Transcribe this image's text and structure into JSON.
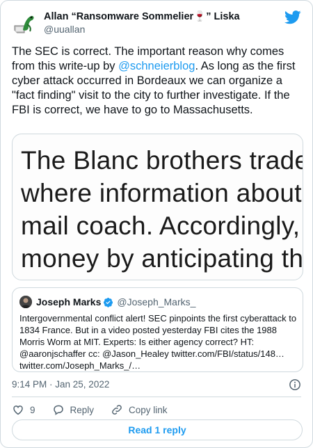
{
  "author": {
    "display_name": "Allan “Ransomware Sommelier🍷” Liska",
    "handle": "@uuallan"
  },
  "tweet": {
    "text_before": "The SEC is correct. The important reason why comes from this write-up by ",
    "mention": "@schneierblog",
    "text_after": ". As long as the first cyber attack occurred in Bordeaux we can organize a \"fact finding\" visit to the city to further investigate. If the FBI is correct, we have to go to Massachusetts."
  },
  "media": {
    "lines": [
      "The Blanc brothers traded g",
      "where information about ma",
      "mail coach. Accordingly, tra",
      "money by anticipating these"
    ]
  },
  "quote": {
    "name": "Joseph Marks",
    "handle": "@Joseph_Marks_",
    "text": "Intergovernmental conflict alert! SEC pinpoints the first cyberattack to 1834 France. But in a video posted yesterday FBI cites the 1988 Morris Worm at MIT. Experts: Is either agency correct? HT: @aaronjschaffer cc: @Jason_Healey  twitter.com/FBI/status/148… twitter.com/Joseph_Marks_/…"
  },
  "meta": {
    "timestamp": "9:14 PM · Jan 25, 2022"
  },
  "actions": {
    "like_count": "9",
    "reply_label": "Reply",
    "copy_label": "Copy link",
    "read_label": "Read 1 reply"
  },
  "colors": {
    "accent": "#1d9bf0",
    "muted": "#536471",
    "border": "#cfd9de"
  }
}
